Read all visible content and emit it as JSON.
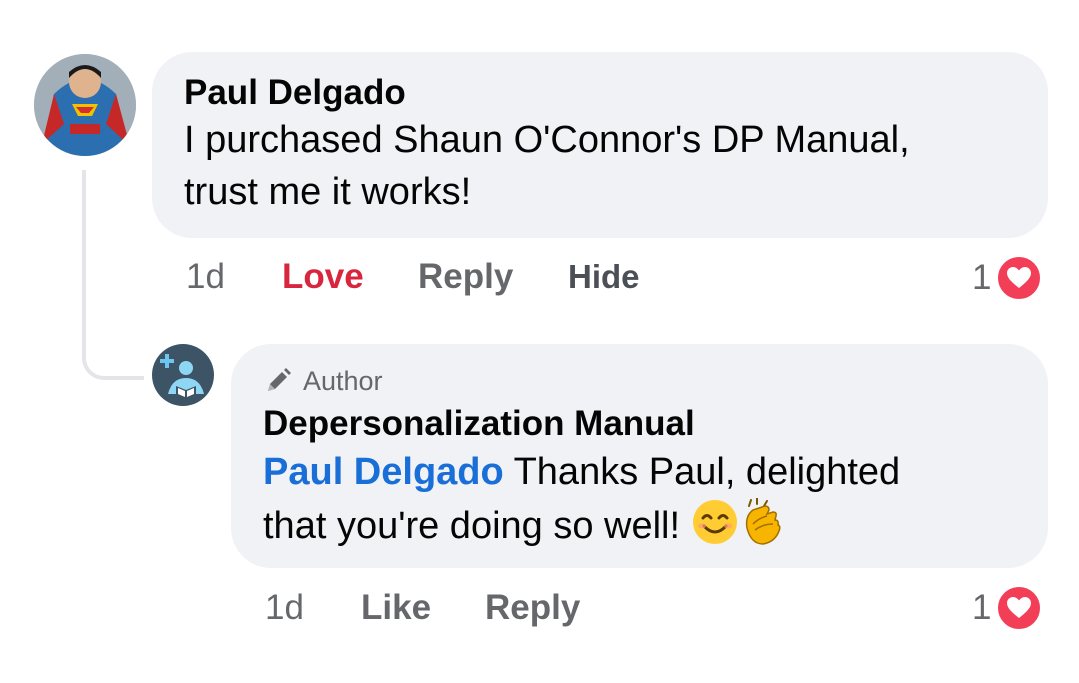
{
  "comment": {
    "author": "Paul Delgado",
    "text_line1": "I purchased Shaun O'Connor's DP Manual,",
    "text_line2": "trust me it works!",
    "time": "1d",
    "love_label": "Love",
    "reply_label": "Reply",
    "hide_label": "Hide",
    "reaction_count": "1",
    "love_color": "#d7263d"
  },
  "reply": {
    "badge_label": "Author",
    "author": "Depersonalization Manual",
    "mention": "Paul Delgado",
    "text_line1": " Thanks Paul, delighted",
    "text_line2": "that you're doing so well! ",
    "emojis": [
      "smiling-face-icon",
      "clapping-hands-icon"
    ],
    "time": "1d",
    "like_label": "Like",
    "reply_label": "Reply",
    "reaction_count": "1"
  }
}
